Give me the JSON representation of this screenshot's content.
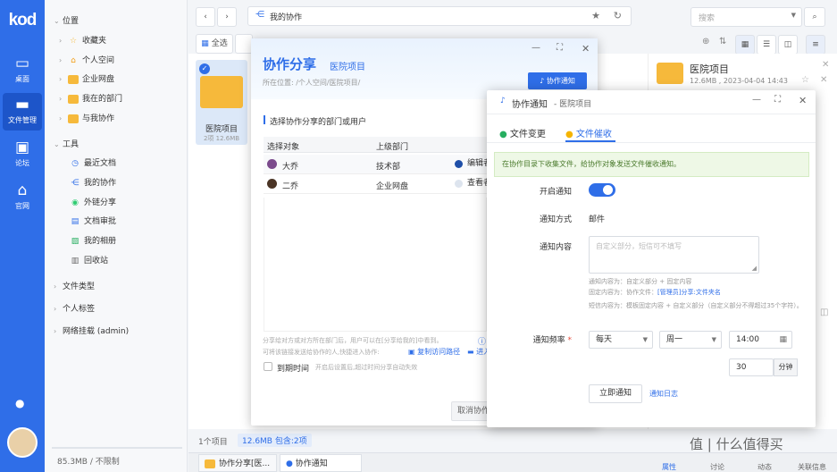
{
  "app": {
    "logo": "kod"
  },
  "rail": {
    "items": [
      {
        "label": "桌面",
        "icon": "desktop-icon"
      },
      {
        "label": "文件管理",
        "icon": "folder-icon"
      },
      {
        "label": "论坛",
        "icon": "forum-icon"
      },
      {
        "label": "官网",
        "icon": "home-icon"
      }
    ]
  },
  "tree": {
    "location": "位置",
    "items": [
      "收藏夹",
      "个人空间",
      "企业网盘",
      "我在的部门",
      "与我协作"
    ],
    "tools": "工具",
    "tool_items": [
      "最近文档",
      "我的协作",
      "外链分享",
      "文档审批",
      "我的相册",
      "回收站"
    ],
    "filetype": "文件类型",
    "personal_tag": "个人标签",
    "network": "网络挂载 (admin)",
    "quota": "85.3MB / 不限制"
  },
  "address": {
    "path": "我的协作"
  },
  "search": {
    "placeholder": "搜索"
  },
  "toolbar": {
    "select_all": "全选"
  },
  "tile": {
    "name": "医院项目",
    "meta": "2项  12.6MB"
  },
  "right_pane": {
    "title": "医院项目",
    "meta": "12.6MB , 2023-04-04 14:43"
  },
  "status": {
    "count": "1个项目",
    "size": "12.6MB 包含:2项"
  },
  "taskbar": {
    "items": [
      "协作分享[医...",
      "协作通知"
    ]
  },
  "right_tabs": [
    "属性",
    "讨论",
    "动态",
    "关联信息"
  ],
  "share": {
    "title": "协作分享",
    "subtitle": "医院项目",
    "path": "所在位置: /个人空间/医院项目/",
    "notify_button": "协作通知",
    "section": "选择协作分享的部门或用户",
    "col_target": "选择对象",
    "col_dept": "上级部门",
    "rows": [
      {
        "name": "大乔",
        "dept": "技术部",
        "perm": "编辑者"
      },
      {
        "name": "二乔",
        "dept": "企业网盘",
        "perm": "查看者"
      }
    ],
    "note1": "分享给对方或对方所在部门后，用户可以在[分享给我的]中看到。",
    "note2": "可将该链接发送给协作的人,快捷进入协作:",
    "copy_link": "复制访问路径",
    "enter": "进入",
    "expire_label": "到期时间",
    "expire_hint": "开启后设置后,超过时间分享自动失效",
    "cancel": "取消协作"
  },
  "notify": {
    "title": "协作通知",
    "subtitle": "- 医院项目",
    "tab1": "文件变更",
    "tab2": "文件催收",
    "banner": "在协作目录下收集文件，给协作对象发送文件催收通知。",
    "enable_label": "开启通知",
    "method_label": "通知方式",
    "method_value": "邮件",
    "content_label": "通知内容",
    "content_placeholder": "自定义部分，短信可不填写",
    "hint1": "通知内容为：自定义部分 + 固定内容",
    "hint2a": "固定内容为：协作文件：",
    "hint2b": "[管理员]分享:文件夹名",
    "hint3": "短信内容为：模板固定内容 + 自定义部分（自定义部分不得超过35个字符）。",
    "freq_label": "通知频率",
    "freq_value": "每天",
    "weekday": "周一",
    "time": "14:00",
    "minutes": "30",
    "minutes_unit": "分钟",
    "send_now": "立即通知",
    "log": "通知日志"
  },
  "watermark": "值 | 什么值得买",
  "colors": {
    "accent": "#2f6ee8",
    "toggle": "#2f6ee8",
    "banner": "#eef8e6"
  }
}
